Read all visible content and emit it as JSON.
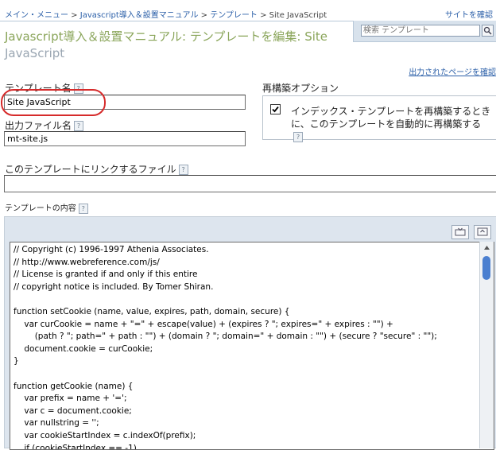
{
  "breadcrumb": {
    "main_menu": "メイン・メニュー",
    "sep": " > ",
    "manual": "Javascript導入＆設置マニュアル",
    "templates": "テンプレート",
    "current": "Site JavaScript"
  },
  "header": {
    "site_confirm": "サイトを確認"
  },
  "search": {
    "placeholder": "検索 テンプレート",
    "button_icon": "search-icon"
  },
  "page": {
    "title_main": "Javascript導入＆設置マニュアル: テンプレートを編集: Site",
    "title_sub": "JavaScript",
    "view_output": "出力されたページを確認"
  },
  "form": {
    "template_name_label": "テンプレート名",
    "template_name_value": "Site JavaScript",
    "output_file_label": "出力ファイル名",
    "output_file_value": "mt-site.js",
    "rebuild_label": "再構築オプション",
    "rebuild_text": "インデックス・テンプレートを再構築するときに、このテンプレートを自動的に再構築する",
    "rebuild_checked": true,
    "linked_file_label": "このテンプレートにリンクするファイル",
    "linked_file_value": "",
    "content_label": "テンプレートの内容",
    "help_glyph": "?"
  },
  "editor": {
    "code": "// Copyright (c) 1996-1997 Athenia Associates.\n// http://www.webreference.com/js/\n// License is granted if and only if this entire\n// copyright notice is included. By Tomer Shiran.\n\nfunction setCookie (name, value, expires, path, domain, secure) {\n    var curCookie = name + \"=\" + escape(value) + (expires ? \"; expires=\" + expires : \"\") +\n        (path ? \"; path=\" + path : \"\") + (domain ? \"; domain=\" + domain : \"\") + (secure ? \"secure\" : \"\");\n    document.cookie = curCookie;\n}\n\nfunction getCookie (name) {\n    var prefix = name + '=';\n    var c = document.cookie;\n    var nullstring = '';\n    var cookieStartIndex = c.indexOf(prefix);\n    if (cookieStartIndex == -1)"
  },
  "colors": {
    "title_green": "#8aa55a",
    "link_blue": "#2b5fa8",
    "annotation_red": "#d62b2b"
  }
}
